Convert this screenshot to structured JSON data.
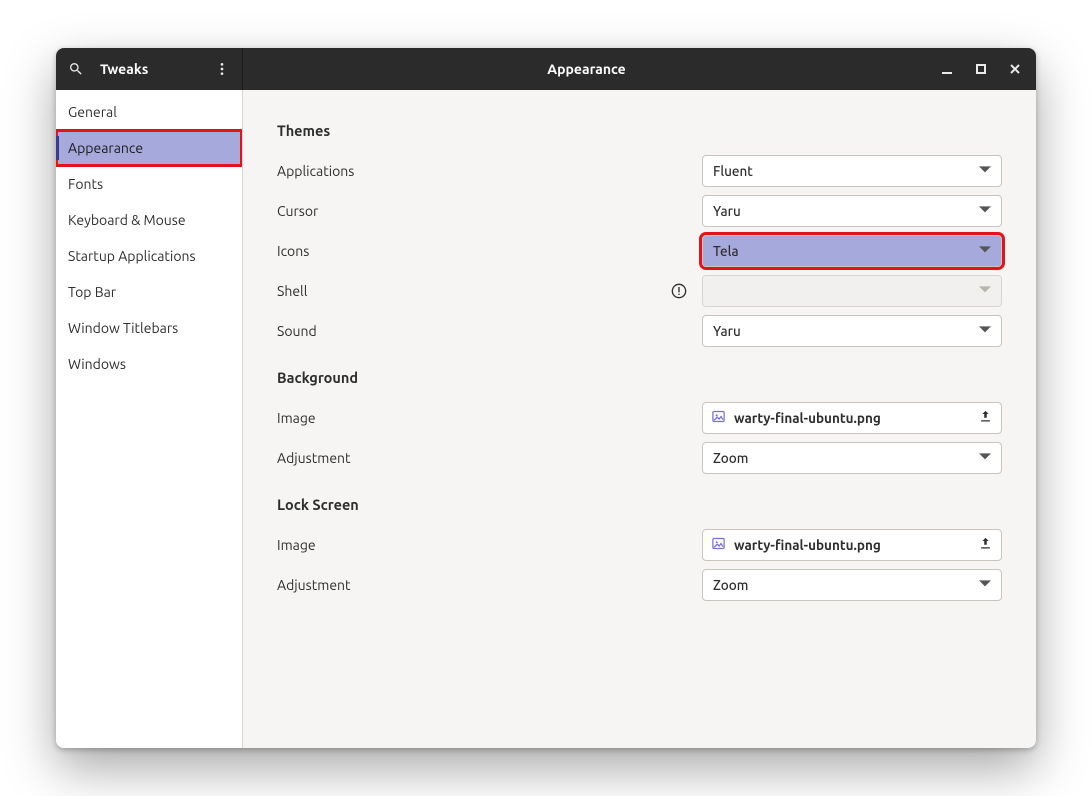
{
  "header": {
    "app_title": "Tweaks",
    "page_title": "Appearance"
  },
  "sidebar": {
    "items": [
      {
        "label": "General"
      },
      {
        "label": "Appearance"
      },
      {
        "label": "Fonts"
      },
      {
        "label": "Keyboard & Mouse"
      },
      {
        "label": "Startup Applications"
      },
      {
        "label": "Top Bar"
      },
      {
        "label": "Window Titlebars"
      },
      {
        "label": "Windows"
      }
    ]
  },
  "sections": {
    "themes": {
      "title": "Themes",
      "applications": {
        "label": "Applications",
        "value": "Fluent"
      },
      "cursor": {
        "label": "Cursor",
        "value": "Yaru"
      },
      "icons": {
        "label": "Icons",
        "value": "Tela"
      },
      "shell": {
        "label": "Shell",
        "value": ""
      },
      "sound": {
        "label": "Sound",
        "value": "Yaru"
      }
    },
    "background": {
      "title": "Background",
      "image": {
        "label": "Image",
        "value": "warty-final-ubuntu.png"
      },
      "adjustment": {
        "label": "Adjustment",
        "value": "Zoom"
      }
    },
    "lockscreen": {
      "title": "Lock Screen",
      "image": {
        "label": "Image",
        "value": "warty-final-ubuntu.png"
      },
      "adjustment": {
        "label": "Adjustment",
        "value": "Zoom"
      }
    }
  }
}
